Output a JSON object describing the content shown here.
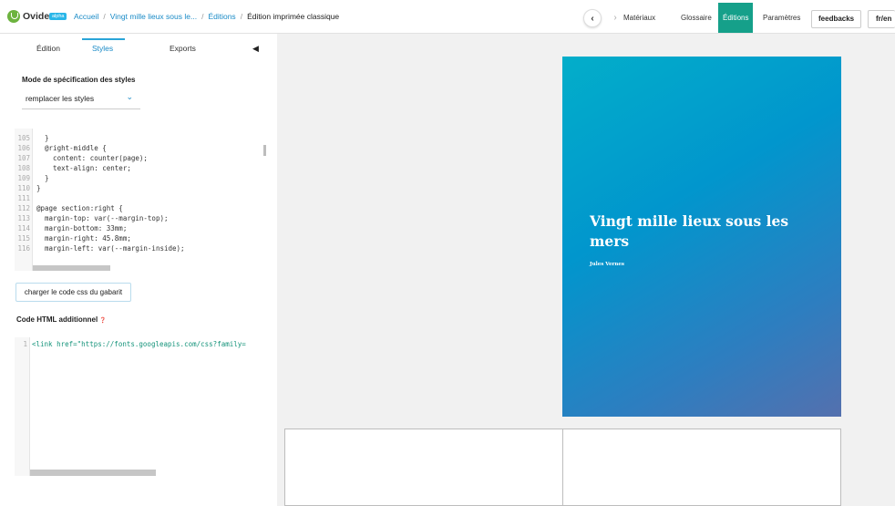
{
  "header": {
    "brand": "Ovide",
    "badge": "alpha",
    "breadcrumb": [
      "Accueil",
      "Vingt mille lieux sous le...",
      "Éditions",
      "Édition imprimée classique"
    ],
    "nav": {
      "back": "‹",
      "forward": "›"
    },
    "menu": [
      "Matériaux",
      "Glossaire",
      "Éditions",
      "Paramètres"
    ],
    "active_menu": "Éditions",
    "feedback_label": "feedbacks",
    "lang_label": "fr/en",
    "accent_color": "#15a08a"
  },
  "sidebar": {
    "tabs": [
      "Édition",
      "Styles",
      "Exports"
    ],
    "active_tab": "Styles",
    "collapse_icon": "◀",
    "mode_title": "Mode de spécification des styles",
    "mode_value": "remplacer les styles",
    "mode_chevron": "⌄",
    "css_lines": [
      {
        "n": "105",
        "t": "  }"
      },
      {
        "n": "106",
        "t": "  @right-middle {"
      },
      {
        "n": "107",
        "t": "    content: counter(page);"
      },
      {
        "n": "108",
        "t": "    text-align: center;"
      },
      {
        "n": "109",
        "t": "  }"
      },
      {
        "n": "110",
        "t": "}"
      },
      {
        "n": "111",
        "t": ""
      },
      {
        "n": "112",
        "t": "@page section:right {"
      },
      {
        "n": "113",
        "t": "  margin-top: var(--margin-top);"
      },
      {
        "n": "114",
        "t": "  margin-bottom: 33mm;"
      },
      {
        "n": "115",
        "t": "  margin-right: 45.8mm;"
      },
      {
        "n": "116",
        "t": "  margin-left: var(--margin-inside);"
      }
    ],
    "load_button": "charger le code css du gabarit",
    "html_title": "Code HTML additionnel",
    "html_help_icon": "❓",
    "html_line_number": "1",
    "html_code": "<link href=\"https://fonts.googleapis.com/css?family="
  },
  "preview": {
    "cover_title": "Vingt mille lieux sous les mers",
    "cover_author": "Jules Vernes"
  }
}
